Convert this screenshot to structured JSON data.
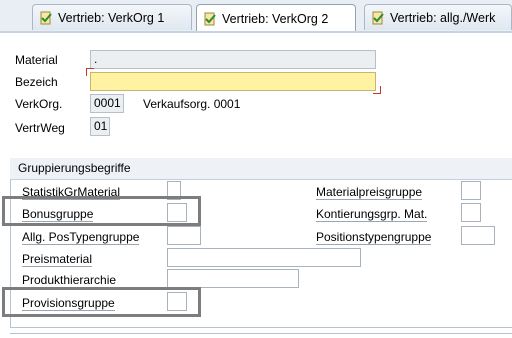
{
  "tabs": [
    {
      "label": "Vertrieb: VerkOrg 1",
      "active": false,
      "icon": "check-document-icon"
    },
    {
      "label": "Vertrieb: VerkOrg 2",
      "active": true,
      "icon": "check-document-icon"
    },
    {
      "label": "Vertrieb: allg./Werk",
      "active": false,
      "icon": "check-document-icon"
    }
  ],
  "header": {
    "material_label": "Material",
    "material_value": ".",
    "bezeich_label": "Bezeich",
    "bezeich_value": "",
    "verkorg_label": "VerkOrg.",
    "verkorg_value": "0001",
    "verkorg_text": "Verkaufsorg. 0001",
    "vertrweg_label": "VertrWeg",
    "vertrweg_value": "01"
  },
  "group": {
    "title": "Gruppierungsbegriffe",
    "left_fields": [
      {
        "label": "StatistikGrMaterial",
        "value": ""
      },
      {
        "label": "Bonusgruppe",
        "value": ""
      },
      {
        "label": "Allg. PosTypengruppe",
        "value": ""
      },
      {
        "label": "Preismaterial",
        "value": ""
      },
      {
        "label": "Produkthierarchie",
        "value": ""
      },
      {
        "label": "Provisionsgruppe",
        "value": ""
      }
    ],
    "right_fields": [
      {
        "label": "Materialpreisgruppe",
        "value": ""
      },
      {
        "label": "Kontierungsgrp. Mat.",
        "value": ""
      },
      {
        "label": "Positionstypengruppe",
        "value": ""
      }
    ]
  },
  "colors": {
    "required_field": "#fff3a3",
    "highlight_box": "#7d7d7d",
    "tab_background": "#e9eef4"
  }
}
